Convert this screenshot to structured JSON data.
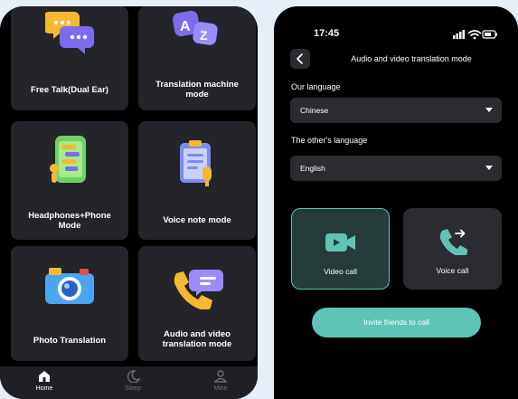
{
  "left": {
    "cards": [
      {
        "label": "Free Talk(Dual Ear)"
      },
      {
        "label": "Translation machine mode"
      },
      {
        "label": "Headphones+Phone Mode"
      },
      {
        "label": "Voice note mode"
      },
      {
        "label": "Photo Translation"
      },
      {
        "label": "Audio and video translation mode"
      }
    ],
    "tabs": [
      {
        "label": "Home",
        "icon": "home-icon",
        "active": true
      },
      {
        "label": "Sleep",
        "icon": "moon-icon",
        "active": false
      },
      {
        "label": "Mine",
        "icon": "user-icon",
        "active": false
      }
    ]
  },
  "right": {
    "status": {
      "time": "17:45"
    },
    "title": "Audio and video translation mode",
    "our_language": {
      "label": "Our language",
      "value": "Chinese"
    },
    "other_language": {
      "label": "The other's language",
      "value": "English"
    },
    "video_call": {
      "label": "Video call",
      "icon": "video-camera-icon"
    },
    "voice_call": {
      "label": "Voice call",
      "icon": "phone-forward-icon"
    },
    "invite_label": "Invite friends to call"
  },
  "colors": {
    "accent": "#5fc4b5",
    "card": "#23252b",
    "background": "#000000"
  }
}
